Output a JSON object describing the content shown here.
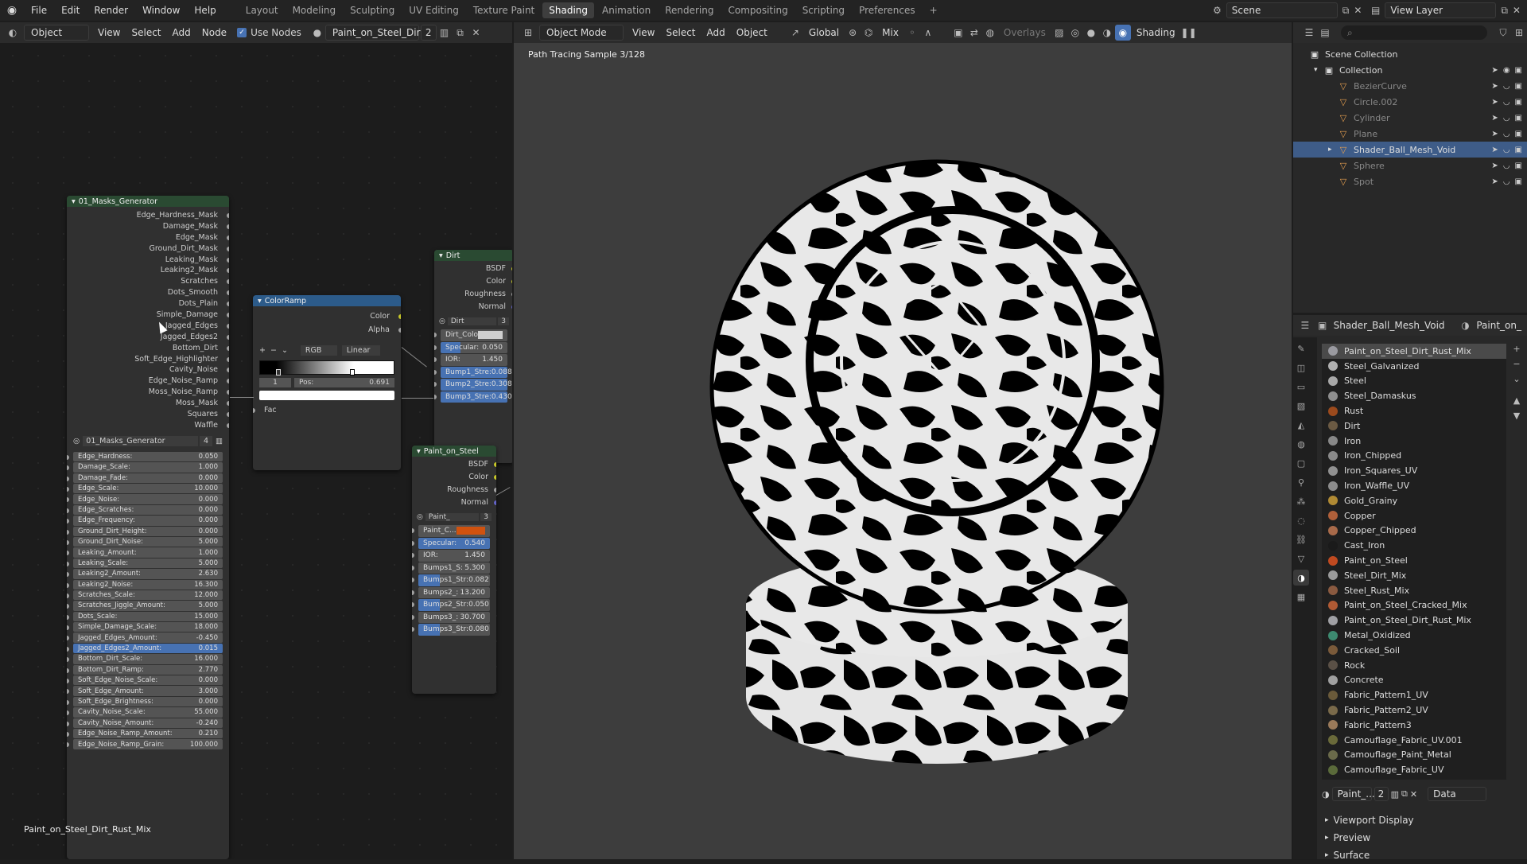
{
  "topbar": {
    "menus": [
      "File",
      "Edit",
      "Render",
      "Window",
      "Help"
    ],
    "workspaces": [
      "Layout",
      "Modeling",
      "Sculpting",
      "UV Editing",
      "Texture Paint",
      "Shading",
      "Animation",
      "Rendering",
      "Compositing",
      "Scripting",
      "Preferences"
    ],
    "active_workspace": "Shading",
    "scene": "Scene",
    "view_layer": "View Layer"
  },
  "node_editor_header": {
    "editor_mode": "Object",
    "menus": [
      "View",
      "Select",
      "Add",
      "Node"
    ],
    "use_nodes": "Use Nodes",
    "material": "Paint_on_Steel_Dirt_",
    "users": "2"
  },
  "viewport_header": {
    "mode": "Object Mode",
    "menus": [
      "View",
      "Select",
      "Add",
      "Object"
    ],
    "orientation": "Global",
    "snap": "Mix",
    "overlays": "Overlays",
    "shading": "Shading",
    "status": "Path Tracing Sample 3/128"
  },
  "masks_node": {
    "title": "01_Masks_Generator",
    "outputs": [
      "Edge_Hardness_Mask",
      "Damage_Mask",
      "Edge_Mask",
      "Ground_Dirt_Mask",
      "Leaking_Mask",
      "Leaking2_Mask",
      "Scratches",
      "Dots_Smooth",
      "Dots_Plain",
      "Simple_Damage",
      "Jagged_Edges",
      "Jagged_Edges2",
      "Bottom_Dirt",
      "Soft_Edge_Highlighter",
      "Cavity_Noise",
      "Edge_Noise_Ramp",
      "Moss_Noise_Ramp",
      "Moss_Mask",
      "Squares",
      "Waffle"
    ],
    "group_name": "01_Masks_Generator",
    "group_users": "4",
    "inputs": [
      {
        "label": "Edge_Hardness:",
        "value": "0.050"
      },
      {
        "label": "Damage_Scale:",
        "value": "1.000"
      },
      {
        "label": "Damage_Fade:",
        "value": "0.000"
      },
      {
        "label": "Edge_Scale:",
        "value": "10.000"
      },
      {
        "label": "Edge_Noise:",
        "value": "0.000"
      },
      {
        "label": "Edge_Scratches:",
        "value": "0.000"
      },
      {
        "label": "Edge_Frequency:",
        "value": "0.000"
      },
      {
        "label": "Ground_Dirt_Height:",
        "value": "0.000"
      },
      {
        "label": "Ground_Dirt_Noise:",
        "value": "5.000"
      },
      {
        "label": "Leaking_Amount:",
        "value": "1.000"
      },
      {
        "label": "Leaking_Scale:",
        "value": "5.000"
      },
      {
        "label": "Leaking2_Amount:",
        "value": "2.630"
      },
      {
        "label": "Leaking2_Noise:",
        "value": "16.300"
      },
      {
        "label": "Scratches_Scale:",
        "value": "12.000"
      },
      {
        "label": "Scratches_Jiggle_Amount:",
        "value": "5.000"
      },
      {
        "label": "Dots_Scale:",
        "value": "15.000"
      },
      {
        "label": "Simple_Damage_Scale:",
        "value": "18.000"
      },
      {
        "label": "Jagged_Edges_Amount:",
        "value": "-0.450"
      },
      {
        "label": "Jagged_Edges2_Amount:",
        "value": "0.015"
      },
      {
        "label": "Bottom_Dirt_Scale:",
        "value": "16.000"
      },
      {
        "label": "Bottom_Dirt_Ramp:",
        "value": "2.770"
      },
      {
        "label": "Soft_Edge_Noise_Scale:",
        "value": "0.000"
      },
      {
        "label": "Soft_Edge_Amount:",
        "value": "3.000"
      },
      {
        "label": "Soft_Edge_Brightness:",
        "value": "0.000"
      },
      {
        "label": "Cavity_Noise_Scale:",
        "value": "55.000"
      },
      {
        "label": "Cavity_Noise_Amount:",
        "value": "-0.240"
      },
      {
        "label": "Edge_Noise_Ramp_Amount:",
        "value": "0.210"
      },
      {
        "label": "Edge_Noise_Ramp_Grain:",
        "value": "100.000"
      }
    ]
  },
  "colorramp_node": {
    "title": "ColorRamp",
    "outputs": [
      "Color",
      "Alpha"
    ],
    "color_mode": "RGB",
    "interpolation": "Linear",
    "stop_index": "1",
    "pos_label": "Pos:",
    "pos_value": "0.691",
    "fac": "Fac"
  },
  "dirt_node": {
    "title": "Dirt",
    "outputs": [
      "BSDF",
      "Color",
      "Roughness",
      "Normal"
    ],
    "group_name": "Dirt",
    "group_users": "3",
    "inputs": [
      {
        "label": "Dirt_Colo",
        "value": ""
      },
      {
        "label": "Specular:",
        "value": "0.050"
      },
      {
        "label": "IOR:",
        "value": "1.450"
      },
      {
        "label": "Bump1_Stre:",
        "value": "0.088"
      },
      {
        "label": "Bump2_Stre:",
        "value": "0.308"
      },
      {
        "label": "Bump3_Stre:",
        "value": "0.430"
      }
    ]
  },
  "paint_node": {
    "title": "Paint_on_Steel",
    "outputs": [
      "BSDF",
      "Color",
      "Roughness",
      "Normal"
    ],
    "group_name": "Paint_",
    "group_users": "3",
    "inputs": [
      {
        "label": "Paint_C...",
        "value": ""
      },
      {
        "label": "Specular:",
        "value": "0.540"
      },
      {
        "label": "IOR:",
        "value": "1.450"
      },
      {
        "label": "Bumps1_S:",
        "value": "5.300"
      },
      {
        "label": "Bumps1_Str:",
        "value": "0.082"
      },
      {
        "label": "Bumps2_:",
        "value": "13.200"
      },
      {
        "label": "Bumps2_Str:",
        "value": "0.050"
      },
      {
        "label": "Bumps3_:",
        "value": "30.700"
      },
      {
        "label": "Bumps3_Str:",
        "value": "0.080"
      }
    ]
  },
  "node_editor_footer": "Paint_on_Steel_Dirt_Rust_Mix",
  "outliner": {
    "root": "Scene Collection",
    "collection": "Collection",
    "items": [
      "BezierCurve",
      "Circle.002",
      "Cylinder",
      "Plane",
      "Shader_Ball_Mesh_Void",
      "Sphere",
      "Spot"
    ],
    "selected": "Shader_Ball_Mesh_Void"
  },
  "properties": {
    "object": "Shader_Ball_Mesh_Void",
    "material_tab": "Paint_on_",
    "materials": [
      {
        "name": "Paint_on_Steel_Dirt_Rust_Mix",
        "color": "#9a9aa0"
      },
      {
        "name": "Steel_Galvanized",
        "color": "#b0b0b0"
      },
      {
        "name": "Steel",
        "color": "#a8a8a8"
      },
      {
        "name": "Steel_Damaskus",
        "color": "#8e8e8e"
      },
      {
        "name": "Rust",
        "color": "#9b4a1d"
      },
      {
        "name": "Dirt",
        "color": "#6b5a43"
      },
      {
        "name": "Iron",
        "color": "#888888"
      },
      {
        "name": "Iron_Chipped",
        "color": "#8a8a8a"
      },
      {
        "name": "Iron_Squares_UV",
        "color": "#909090"
      },
      {
        "name": "Iron_Waffle_UV",
        "color": "#8c8c8c"
      },
      {
        "name": "Gold_Grainy",
        "color": "#b08a34"
      },
      {
        "name": "Copper",
        "color": "#b0603a"
      },
      {
        "name": "Copper_Chipped",
        "color": "#a86a4a"
      },
      {
        "name": "Cast_Iron",
        "color": "#1a1a1a"
      },
      {
        "name": "Paint_on_Steel",
        "color": "#c04a20"
      },
      {
        "name": "Steel_Dirt_Mix",
        "color": "#9a9a9a"
      },
      {
        "name": "Steel_Rust_Mix",
        "color": "#8a5a40"
      },
      {
        "name": "Paint_on_Steel_Cracked_Mix",
        "color": "#b05a34"
      },
      {
        "name": "Paint_on_Steel_Dirt_Rust_Mix",
        "color": "#a0a0a4"
      },
      {
        "name": "Metal_Oxidized",
        "color": "#3d8a70"
      },
      {
        "name": "Cracked_Soil",
        "color": "#7a5a3a"
      },
      {
        "name": "Rock",
        "color": "#5a5046"
      },
      {
        "name": "Concrete",
        "color": "#a0a0a0"
      },
      {
        "name": "Fabric_Pattern1_UV",
        "color": "#6a5a3a"
      },
      {
        "name": "Fabric_Pattern2_UV",
        "color": "#7a6a4a"
      },
      {
        "name": "Fabric_Pattern3",
        "color": "#9a7a5a"
      },
      {
        "name": "Camouflage_Fabric_UV.001",
        "color": "#6a6a3a"
      },
      {
        "name": "Camouflage_Paint_Metal",
        "color": "#6a6a4a"
      },
      {
        "name": "Camouflage_Fabric_UV",
        "color": "#5a6a3a"
      }
    ],
    "slot_name": "Paint_...",
    "slot_users": "2",
    "link": "Data",
    "sections": [
      "Viewport Display",
      "Preview",
      "Surface"
    ]
  }
}
